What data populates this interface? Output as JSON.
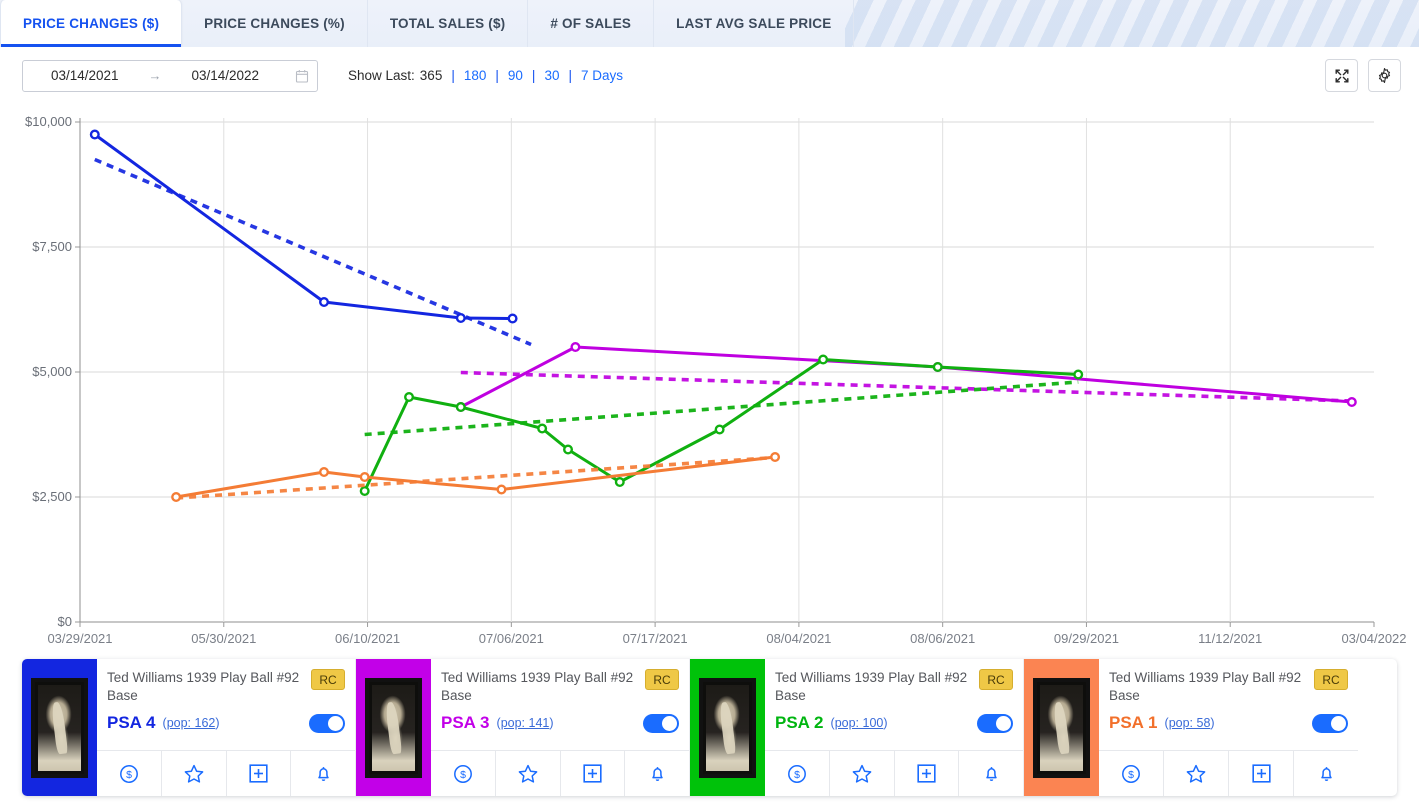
{
  "tabs": [
    {
      "label": "PRICE CHANGES ($)",
      "active": true
    },
    {
      "label": "PRICE CHANGES (%)",
      "active": false
    },
    {
      "label": "TOTAL SALES ($)",
      "active": false
    },
    {
      "label": "# OF SALES",
      "active": false
    },
    {
      "label": "LAST AVG SALE PRICE",
      "active": false
    }
  ],
  "toolbar": {
    "start_date": "03/14/2021",
    "end_date": "03/14/2022",
    "range_arrow": "→",
    "calendar_icon": "calendar-icon",
    "show_last_label": "Show Last:",
    "show_last_current": "365",
    "separator": "|",
    "options": [
      "180",
      "90",
      "30",
      "7 Days"
    ],
    "expand_icon": "expand-icon",
    "settings_icon": "gear-icon"
  },
  "chart_data": {
    "type": "line",
    "title": "",
    "xlabel": "",
    "ylabel": "",
    "ylim": [
      0,
      10000
    ],
    "yticks": [
      0,
      2500,
      5000,
      7500,
      10000
    ],
    "ytick_labels": [
      "$0",
      "$2,500",
      "$5,000",
      "$7,500",
      "$10,000"
    ],
    "grid": true,
    "legend": "bottom-cards",
    "categories": [
      "03/29/2021",
      "05/30/2021",
      "06/10/2021",
      "07/06/2021",
      "07/17/2021",
      "08/04/2021",
      "08/06/2021",
      "09/29/2021",
      "11/12/2021",
      "03/04/2022"
    ],
    "series": [
      {
        "name": "PSA 4",
        "color": "#1326e0",
        "x": [
          "03/29/2021",
          "05/30/2021",
          "07/06/2021",
          "07/20/2021"
        ],
        "values": [
          9750,
          6400,
          6080,
          6070
        ],
        "trend": {
          "x": [
            "03/29/2021",
            "07/25/2021"
          ],
          "values": [
            9250,
            5550
          ],
          "style": "dotted"
        }
      },
      {
        "name": "PSA 3",
        "color": "#bf00e0",
        "x": [
          "07/06/2021",
          "08/06/2021",
          "11/12/2021",
          "03/04/2022"
        ],
        "values": [
          4300,
          5500,
          5100,
          4400
        ],
        "trend": {
          "x": [
            "07/06/2021",
            "03/04/2022"
          ],
          "values": [
            4990,
            4420
          ],
          "style": "dotted"
        }
      },
      {
        "name": "PSA 2",
        "color": "#10b010",
        "x": [
          "06/10/2021",
          "06/22/2021",
          "07/06/2021",
          "07/28/2021",
          "08/04/2021",
          "08/18/2021",
          "09/14/2021",
          "10/12/2021",
          "11/12/2021",
          "12/20/2021"
        ],
        "values": [
          2620,
          4500,
          4300,
          3870,
          3450,
          2800,
          3850,
          5250,
          5100,
          4950
        ],
        "trend": {
          "x": [
            "06/10/2021",
            "12/20/2021"
          ],
          "values": [
            3750,
            4800
          ],
          "style": "dotted"
        }
      },
      {
        "name": "PSA 1",
        "color": "#f47c35",
        "x": [
          "04/20/2021",
          "05/30/2021",
          "06/10/2021",
          "07/17/2021",
          "09/29/2021"
        ],
        "values": [
          2500,
          3000,
          2900,
          2650,
          3300
        ],
        "trend": {
          "x": [
            "04/20/2021",
            "09/29/2021"
          ],
          "values": [
            2480,
            3290
          ],
          "style": "dotted"
        }
      }
    ]
  },
  "legend_cards": [
    {
      "accent": "#1326e0",
      "grade_color": "#1326e0",
      "title": "Ted Williams 1939 Play Ball #92 Base",
      "badge": "RC",
      "grade": "PSA 4",
      "pop_prefix": "(",
      "pop": "pop: 162",
      "pop_suffix": ")",
      "toggle_on": true,
      "actions": [
        "dollar-icon",
        "star-icon",
        "plus-icon",
        "bell-icon"
      ]
    },
    {
      "accent": "#c200e8",
      "grade_color": "#c200e8",
      "title": "Ted Williams 1939 Play Ball #92 Base",
      "badge": "RC",
      "grade": "PSA 3",
      "pop_prefix": "(",
      "pop": "pop: 141",
      "pop_suffix": ")",
      "toggle_on": true,
      "actions": [
        "dollar-icon",
        "star-icon",
        "plus-icon",
        "bell-icon"
      ]
    },
    {
      "accent": "#00c20a",
      "grade_color": "#00b510",
      "title": "Ted Williams 1939 Play Ball #92 Base",
      "badge": "RC",
      "grade": "PSA 2",
      "pop_prefix": "(",
      "pop": "pop: 100",
      "pop_suffix": ")",
      "toggle_on": true,
      "actions": [
        "dollar-icon",
        "star-icon",
        "plus-icon",
        "bell-icon"
      ]
    },
    {
      "accent": "#fb8452",
      "grade_color": "#f2702b",
      "title": "Ted Williams 1939 Play Ball #92 Base",
      "badge": "RC",
      "grade": "PSA 1",
      "pop_prefix": "(",
      "pop": "pop: 58",
      "pop_suffix": ")",
      "toggle_on": true,
      "actions": [
        "dollar-icon",
        "star-icon",
        "plus-icon",
        "bell-icon"
      ]
    }
  ]
}
